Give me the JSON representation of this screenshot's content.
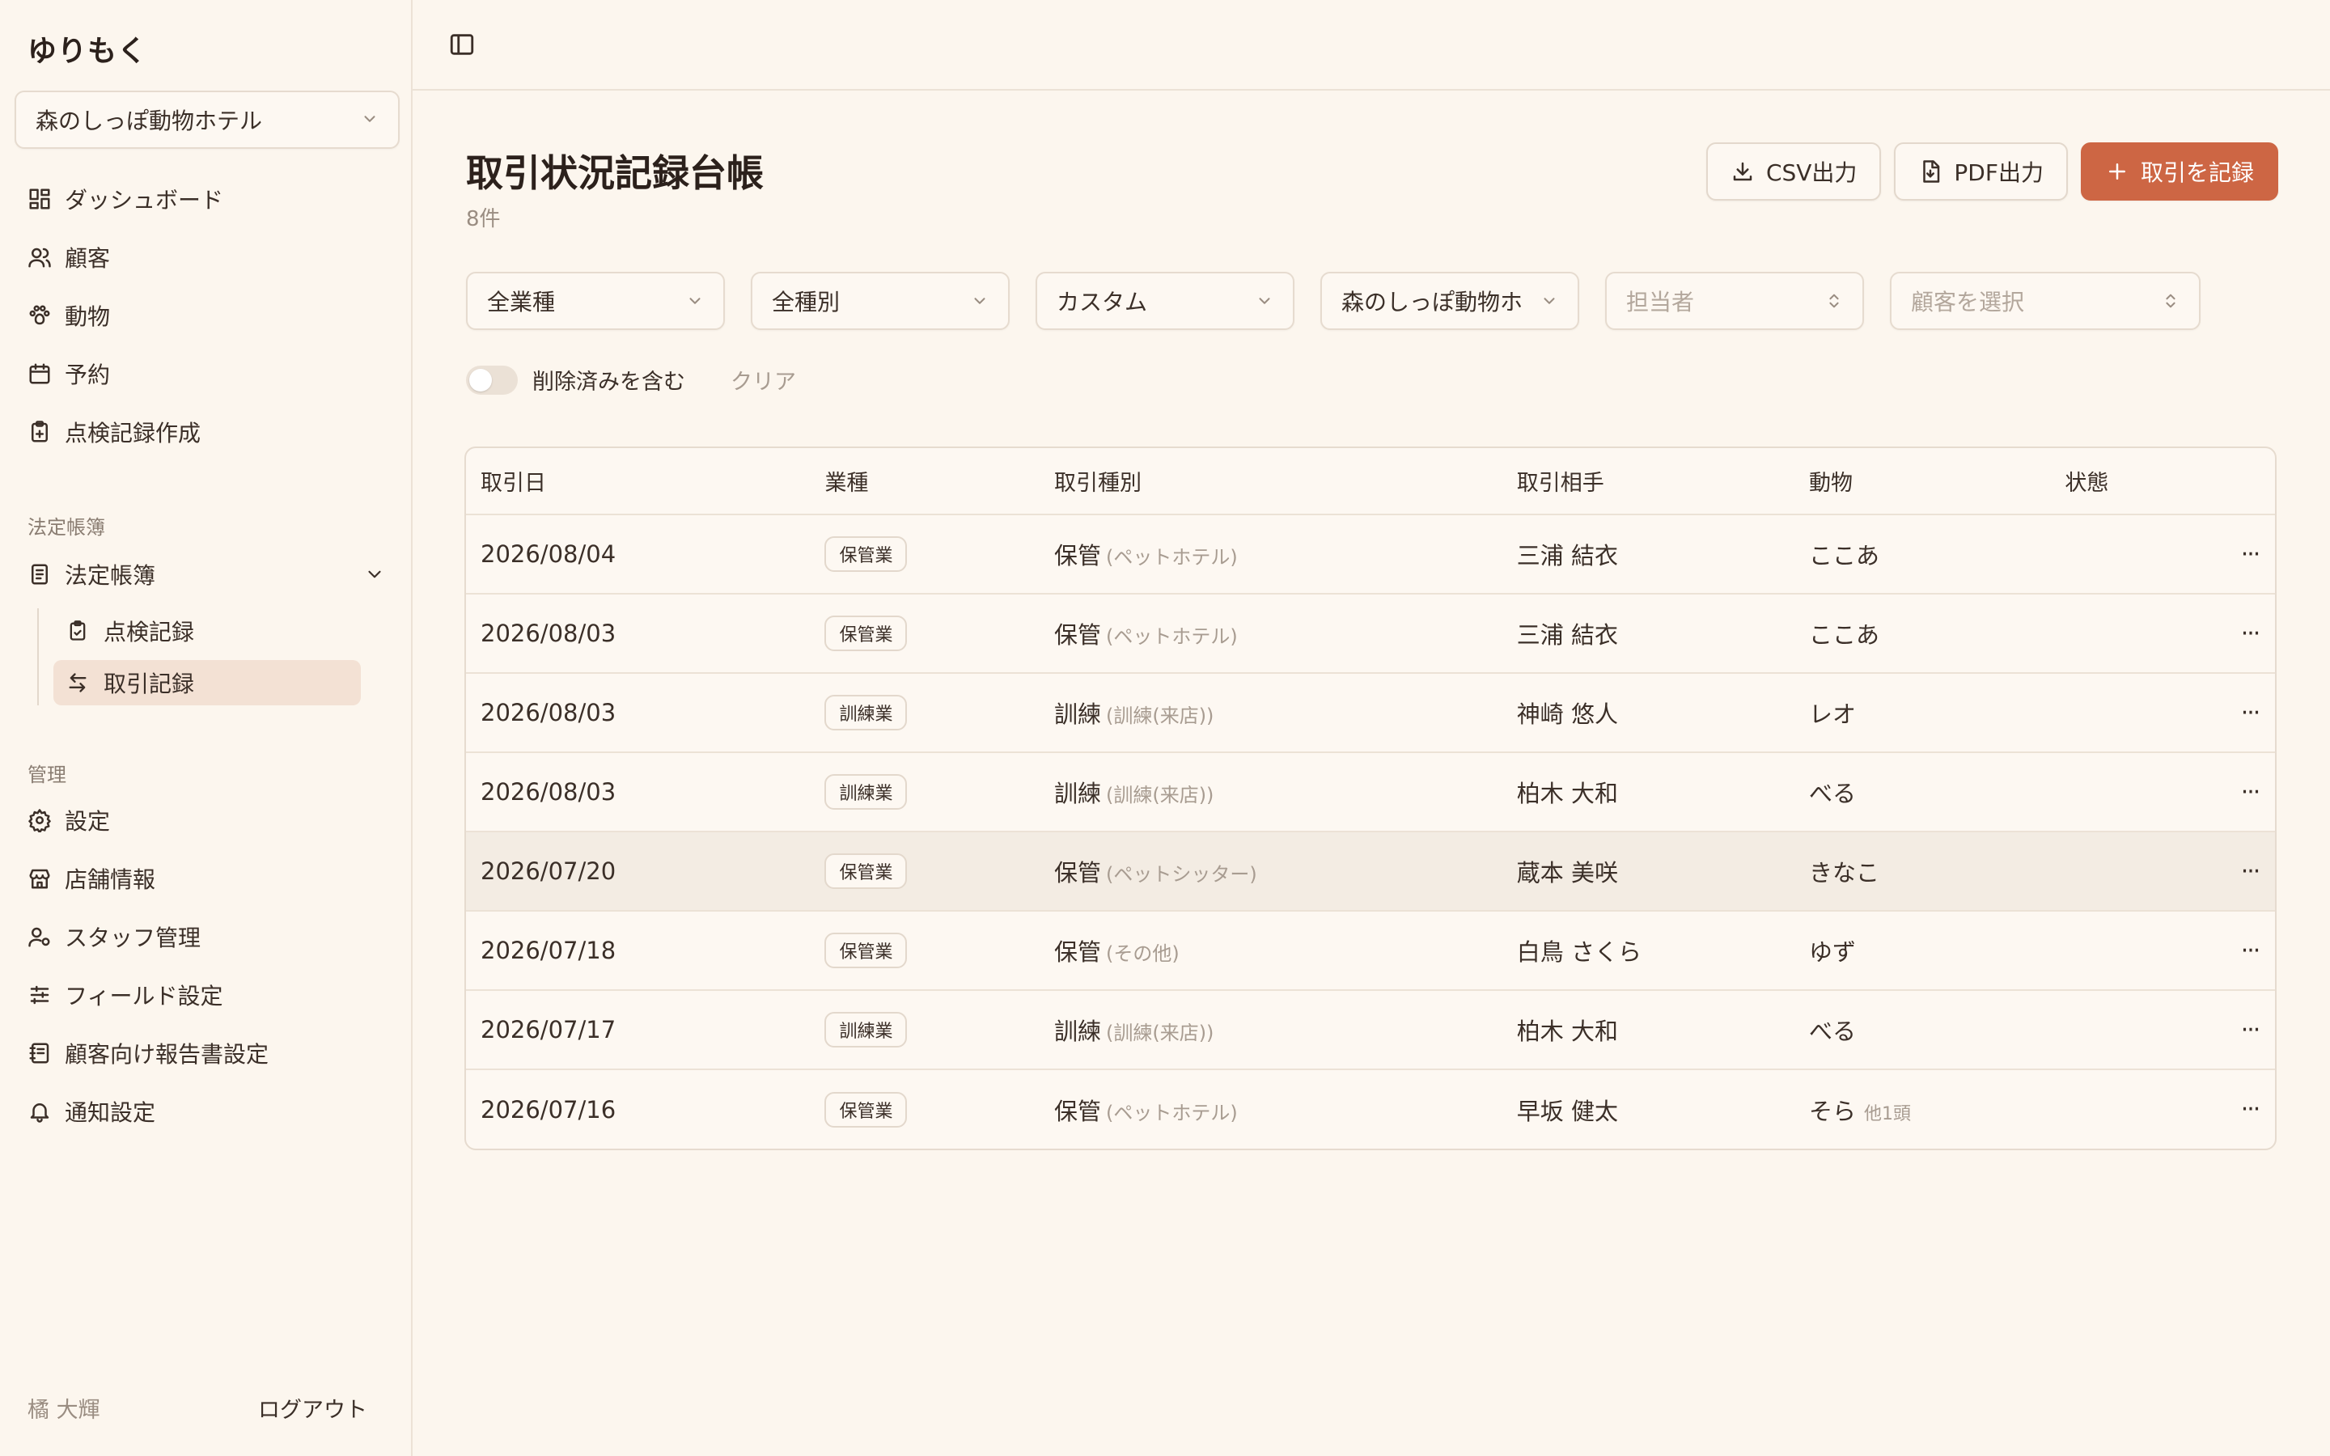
{
  "brand": "ゆりもく",
  "store_select": "森のしっぽ動物ホテル",
  "nav": [
    {
      "label": "ダッシュボード",
      "icon": "dashboard-icon"
    },
    {
      "label": "顧客",
      "icon": "users-icon"
    },
    {
      "label": "動物",
      "icon": "paw-icon"
    },
    {
      "label": "予約",
      "icon": "calendar-icon"
    },
    {
      "label": "点検記録作成",
      "icon": "clipboard-plus-icon"
    }
  ],
  "section_ledger": "法定帳簿",
  "ledger_group": {
    "label": "法定帳簿",
    "icon": "book-icon"
  },
  "ledger_items": [
    {
      "label": "点検記録",
      "icon": "clipboard-check-icon"
    },
    {
      "label": "取引記録",
      "icon": "transfer-icon",
      "active": true
    }
  ],
  "section_admin": "管理",
  "admin_nav": [
    {
      "label": "設定",
      "icon": "gear-icon"
    },
    {
      "label": "店舗情報",
      "icon": "store-icon"
    },
    {
      "label": "スタッフ管理",
      "icon": "user-cog-icon"
    },
    {
      "label": "フィールド設定",
      "icon": "sliders-icon"
    },
    {
      "label": "顧客向け報告書設定",
      "icon": "notebook-icon"
    },
    {
      "label": "通知設定",
      "icon": "bell-icon"
    }
  ],
  "user": {
    "name": "橘 大輝",
    "logout": "ログアウト"
  },
  "page": {
    "title": "取引状況記録台帳",
    "count": "8件"
  },
  "actions": {
    "csv": "CSV出力",
    "pdf": "PDF出力",
    "add": "取引を記録"
  },
  "filters": {
    "industry": "全業種",
    "type": "全種別",
    "period": "カスタム",
    "store": "森のしっぽ動物ホ",
    "staff_placeholder": "担当者",
    "customer_placeholder": "顧客を選択"
  },
  "toggle": {
    "label": "削除済みを含む",
    "on": false
  },
  "clear": "クリア",
  "table": {
    "headers": [
      "取引日",
      "業種",
      "取引種別",
      "取引相手",
      "動物",
      "状態"
    ],
    "rows": [
      {
        "date": "2026/08/04",
        "industry": "保管業",
        "type": "保管",
        "type_sub": "(ペットホテル)",
        "partner": "三浦 結衣",
        "animal": "ここあ",
        "extra": ""
      },
      {
        "date": "2026/08/03",
        "industry": "保管業",
        "type": "保管",
        "type_sub": "(ペットホテル)",
        "partner": "三浦 結衣",
        "animal": "ここあ",
        "extra": ""
      },
      {
        "date": "2026/08/03",
        "industry": "訓練業",
        "type": "訓練",
        "type_sub": "(訓練(来店))",
        "partner": "神崎 悠人",
        "animal": "レオ",
        "extra": ""
      },
      {
        "date": "2026/08/03",
        "industry": "訓練業",
        "type": "訓練",
        "type_sub": "(訓練(来店))",
        "partner": "柏木 大和",
        "animal": "べる",
        "extra": ""
      },
      {
        "date": "2026/07/20",
        "industry": "保管業",
        "type": "保管",
        "type_sub": "(ペットシッター)",
        "partner": "蔵本 美咲",
        "animal": "きなこ",
        "extra": "",
        "hover": true
      },
      {
        "date": "2026/07/18",
        "industry": "保管業",
        "type": "保管",
        "type_sub": "(その他)",
        "partner": "白鳥 さくら",
        "animal": "ゆず",
        "extra": ""
      },
      {
        "date": "2026/07/17",
        "industry": "訓練業",
        "type": "訓練",
        "type_sub": "(訓練(来店))",
        "partner": "柏木 大和",
        "animal": "べる",
        "extra": ""
      },
      {
        "date": "2026/07/16",
        "industry": "保管業",
        "type": "保管",
        "type_sub": "(ペットホテル)",
        "partner": "早坂 健太",
        "animal": "そら",
        "extra": "他1頭"
      }
    ],
    "row_menu_glyph": "···"
  },
  "colors": {
    "accent": "#cd6644",
    "background": "#fcf6ee",
    "active_nav": "#f3e1d4"
  }
}
